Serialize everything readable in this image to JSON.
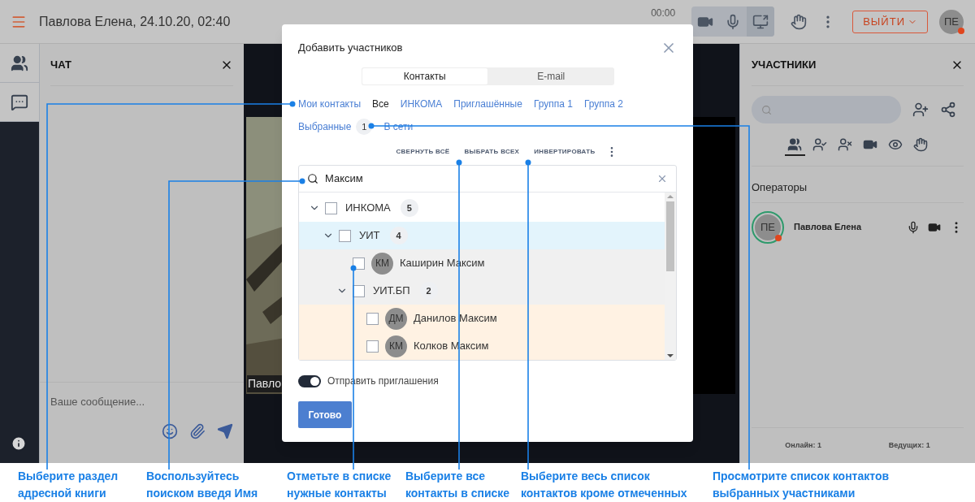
{
  "top_bar": {
    "title": "Павлова Елена, 24.10.20, 02:40",
    "timer": "00:00",
    "media_controls": [
      {
        "kind": "camera",
        "selected": false
      },
      {
        "kind": "mic",
        "selected": false
      },
      {
        "kind": "screen",
        "selected": true
      }
    ],
    "exit_button": "ВЫЙТИ",
    "avatar": "ПЕ"
  },
  "side_rail": {
    "items": [
      {
        "kind": "participants"
      },
      {
        "kind": "chat"
      }
    ]
  },
  "chat": {
    "title": "ЧАТ",
    "message_field": {
      "placeholder": "Ваше сообщение..."
    }
  },
  "video": {
    "label": "Павло"
  },
  "participants_panel": {
    "title": "УЧАСТНИКИ",
    "filters": [
      {
        "kind": "all",
        "selected": true
      },
      {
        "kind": "approved",
        "selected": false
      },
      {
        "kind": "removed",
        "selected": false
      },
      {
        "kind": "video",
        "selected": false
      },
      {
        "kind": "viewers",
        "selected": false
      },
      {
        "kind": "hands",
        "selected": false
      }
    ],
    "section": "Операторы",
    "participants": [
      {
        "initials": "ПЕ",
        "name": "Павлова Елена"
      }
    ],
    "footer": [
      "Онлайн: 1",
      "Ведущих: 1"
    ]
  },
  "modal": {
    "title": "Добавить участников",
    "tabs": [
      {
        "label": "Контакты",
        "selected": true
      },
      {
        "label": "E-mail",
        "selected": false
      }
    ],
    "sections": [
      {
        "label": "Мои контакты",
        "selected": false
      },
      {
        "label": "Все",
        "selected": true
      },
      {
        "label": "ИНКОМА",
        "selected": false
      },
      {
        "label": "Приглашённые",
        "selected": false
      },
      {
        "label": "Группа 1",
        "selected": false
      },
      {
        "label": "Группа 2",
        "selected": false
      },
      {
        "label": "Выбранные",
        "selected": false,
        "badge": "1"
      },
      {
        "label": "В сети",
        "selected": false
      }
    ],
    "actions": [
      "СВЕРНУТЬ ВСЁ",
      "ВЫБРАТЬ ВСЕХ",
      "ИНВЕРТИРОВАТЬ"
    ],
    "search": {
      "value": "Максим"
    },
    "tree": [
      {
        "kind": "group",
        "label": "ИНКОМА",
        "count": "5",
        "expanded": true,
        "checked": false,
        "color": "#ffffff",
        "children": [
          {
            "kind": "group",
            "label": "УИТ",
            "count": "4",
            "expanded": true,
            "checked": false,
            "color": "#e3f4fc",
            "children": [
              {
                "kind": "contact",
                "initials": "КМ",
                "label": "Каширин Максим",
                "checked": false,
                "color": "#f0f0f0"
              },
              {
                "kind": "group",
                "label": "УИТ.БП",
                "count": "2",
                "expanded": true,
                "checked": false,
                "color": "#f0f0f0",
                "children": [
                  {
                    "kind": "contact",
                    "initials": "ДМ",
                    "label": "Данилов Максим",
                    "checked": false,
                    "color": "#fff2e3"
                  },
                  {
                    "kind": "contact",
                    "initials": "КМ",
                    "label": "Колков Максим",
                    "checked": false,
                    "color": "#fff2e3"
                  }
                ]
              }
            ]
          }
        ]
      }
    ],
    "send_invites": {
      "label": "Отправить приглашения",
      "on": true
    },
    "done_button": "Готово"
  },
  "annotations": [
    [
      "Выберите раздел",
      "адресной книги"
    ],
    [
      "Воспользуйтесь",
      "поиском введя Имя"
    ],
    [
      "Отметьте в списке",
      "нужные контакты"
    ],
    [
      "Выберите все",
      "контакты в списке"
    ],
    [
      "Выберите весь список",
      "контактов кроме отмеченных"
    ],
    [
      "Просмотрите список контактов",
      "выбранных участниками"
    ]
  ]
}
